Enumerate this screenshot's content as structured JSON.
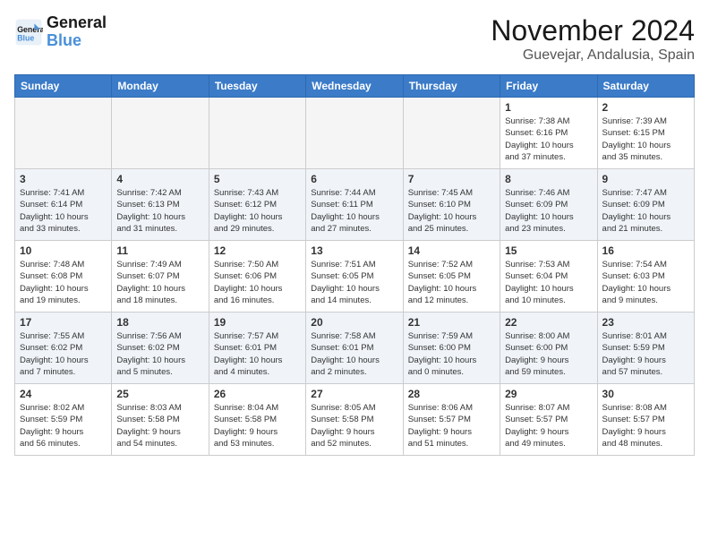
{
  "logo": {
    "line1": "General",
    "line2": "Blue"
  },
  "title": "November 2024",
  "location": "Guevejar, Andalusia, Spain",
  "weekdays": [
    "Sunday",
    "Monday",
    "Tuesday",
    "Wednesday",
    "Thursday",
    "Friday",
    "Saturday"
  ],
  "weeks": [
    [
      {
        "day": "",
        "info": ""
      },
      {
        "day": "",
        "info": ""
      },
      {
        "day": "",
        "info": ""
      },
      {
        "day": "",
        "info": ""
      },
      {
        "day": "",
        "info": ""
      },
      {
        "day": "1",
        "info": "Sunrise: 7:38 AM\nSunset: 6:16 PM\nDaylight: 10 hours\nand 37 minutes."
      },
      {
        "day": "2",
        "info": "Sunrise: 7:39 AM\nSunset: 6:15 PM\nDaylight: 10 hours\nand 35 minutes."
      }
    ],
    [
      {
        "day": "3",
        "info": "Sunrise: 7:41 AM\nSunset: 6:14 PM\nDaylight: 10 hours\nand 33 minutes."
      },
      {
        "day": "4",
        "info": "Sunrise: 7:42 AM\nSunset: 6:13 PM\nDaylight: 10 hours\nand 31 minutes."
      },
      {
        "day": "5",
        "info": "Sunrise: 7:43 AM\nSunset: 6:12 PM\nDaylight: 10 hours\nand 29 minutes."
      },
      {
        "day": "6",
        "info": "Sunrise: 7:44 AM\nSunset: 6:11 PM\nDaylight: 10 hours\nand 27 minutes."
      },
      {
        "day": "7",
        "info": "Sunrise: 7:45 AM\nSunset: 6:10 PM\nDaylight: 10 hours\nand 25 minutes."
      },
      {
        "day": "8",
        "info": "Sunrise: 7:46 AM\nSunset: 6:09 PM\nDaylight: 10 hours\nand 23 minutes."
      },
      {
        "day": "9",
        "info": "Sunrise: 7:47 AM\nSunset: 6:09 PM\nDaylight: 10 hours\nand 21 minutes."
      }
    ],
    [
      {
        "day": "10",
        "info": "Sunrise: 7:48 AM\nSunset: 6:08 PM\nDaylight: 10 hours\nand 19 minutes."
      },
      {
        "day": "11",
        "info": "Sunrise: 7:49 AM\nSunset: 6:07 PM\nDaylight: 10 hours\nand 18 minutes."
      },
      {
        "day": "12",
        "info": "Sunrise: 7:50 AM\nSunset: 6:06 PM\nDaylight: 10 hours\nand 16 minutes."
      },
      {
        "day": "13",
        "info": "Sunrise: 7:51 AM\nSunset: 6:05 PM\nDaylight: 10 hours\nand 14 minutes."
      },
      {
        "day": "14",
        "info": "Sunrise: 7:52 AM\nSunset: 6:05 PM\nDaylight: 10 hours\nand 12 minutes."
      },
      {
        "day": "15",
        "info": "Sunrise: 7:53 AM\nSunset: 6:04 PM\nDaylight: 10 hours\nand 10 minutes."
      },
      {
        "day": "16",
        "info": "Sunrise: 7:54 AM\nSunset: 6:03 PM\nDaylight: 10 hours\nand 9 minutes."
      }
    ],
    [
      {
        "day": "17",
        "info": "Sunrise: 7:55 AM\nSunset: 6:02 PM\nDaylight: 10 hours\nand 7 minutes."
      },
      {
        "day": "18",
        "info": "Sunrise: 7:56 AM\nSunset: 6:02 PM\nDaylight: 10 hours\nand 5 minutes."
      },
      {
        "day": "19",
        "info": "Sunrise: 7:57 AM\nSunset: 6:01 PM\nDaylight: 10 hours\nand 4 minutes."
      },
      {
        "day": "20",
        "info": "Sunrise: 7:58 AM\nSunset: 6:01 PM\nDaylight: 10 hours\nand 2 minutes."
      },
      {
        "day": "21",
        "info": "Sunrise: 7:59 AM\nSunset: 6:00 PM\nDaylight: 10 hours\nand 0 minutes."
      },
      {
        "day": "22",
        "info": "Sunrise: 8:00 AM\nSunset: 6:00 PM\nDaylight: 9 hours\nand 59 minutes."
      },
      {
        "day": "23",
        "info": "Sunrise: 8:01 AM\nSunset: 5:59 PM\nDaylight: 9 hours\nand 57 minutes."
      }
    ],
    [
      {
        "day": "24",
        "info": "Sunrise: 8:02 AM\nSunset: 5:59 PM\nDaylight: 9 hours\nand 56 minutes."
      },
      {
        "day": "25",
        "info": "Sunrise: 8:03 AM\nSunset: 5:58 PM\nDaylight: 9 hours\nand 54 minutes."
      },
      {
        "day": "26",
        "info": "Sunrise: 8:04 AM\nSunset: 5:58 PM\nDaylight: 9 hours\nand 53 minutes."
      },
      {
        "day": "27",
        "info": "Sunrise: 8:05 AM\nSunset: 5:58 PM\nDaylight: 9 hours\nand 52 minutes."
      },
      {
        "day": "28",
        "info": "Sunrise: 8:06 AM\nSunset: 5:57 PM\nDaylight: 9 hours\nand 51 minutes."
      },
      {
        "day": "29",
        "info": "Sunrise: 8:07 AM\nSunset: 5:57 PM\nDaylight: 9 hours\nand 49 minutes."
      },
      {
        "day": "30",
        "info": "Sunrise: 8:08 AM\nSunset: 5:57 PM\nDaylight: 9 hours\nand 48 minutes."
      }
    ]
  ]
}
